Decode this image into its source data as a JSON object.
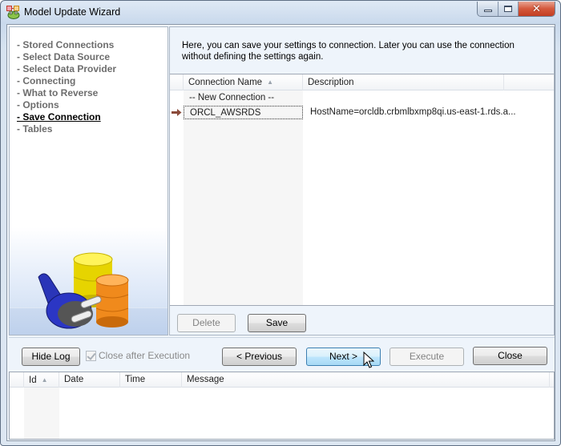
{
  "window": {
    "title": "Model Update Wizard",
    "app_icon": "frog-database-icon",
    "caption_buttons": {
      "minimize": "minimize-icon",
      "maximize": "maximize-icon",
      "close": "close-icon"
    }
  },
  "steps": {
    "items": [
      {
        "label": "- Stored Connections",
        "active": false
      },
      {
        "label": "- Select Data Source",
        "active": false
      },
      {
        "label": "- Select Data Provider",
        "active": false
      },
      {
        "label": "- Connecting",
        "active": false
      },
      {
        "label": "- What to Reverse",
        "active": false
      },
      {
        "label": "- Options",
        "active": false
      },
      {
        "label": "- Save Connection",
        "active": true
      },
      {
        "label": "- Tables",
        "active": false
      }
    ]
  },
  "main": {
    "intro_text": "Here, you can save your settings to connection. Later you can use the connection without defining the settings again.",
    "grid": {
      "columns": [
        {
          "label": "Connection Name",
          "sorted": "ascending"
        },
        {
          "label": "Description"
        }
      ],
      "rows": [
        {
          "name": "-- New Connection --",
          "description": "",
          "current": false
        },
        {
          "name": "ORCL_AWSRDS",
          "description": "HostName=orcldb.crbmlbxmp8qi.us-east-1.rds.a...",
          "current": true
        }
      ]
    },
    "buttons": {
      "delete": {
        "label": "Delete",
        "enabled": false
      },
      "save": {
        "label": "Save",
        "enabled": true
      }
    }
  },
  "action_bar": {
    "hide_log": "Hide Log",
    "close_after_execution": {
      "label": "Close after Execution",
      "checked": true,
      "enabled": false
    },
    "previous": "< Previous",
    "next": "Next >",
    "execute": {
      "label": "Execute",
      "enabled": false
    },
    "close": "Close"
  },
  "log": {
    "columns": [
      {
        "label": "Id",
        "sorted": "ascending"
      },
      {
        "label": "Date"
      },
      {
        "label": "Time"
      },
      {
        "label": "Message"
      }
    ],
    "rows": []
  },
  "colors": {
    "row_indicator_arrow": "#8b4a3a",
    "hover_button": "#bee6fd"
  }
}
